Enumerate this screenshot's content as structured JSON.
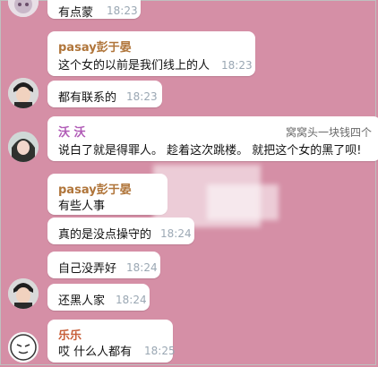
{
  "messages": [
    {
      "sender": "",
      "text": "有点蒙",
      "time": "18:23"
    },
    {
      "sender": "pasay彭于晏",
      "sender_color": "#b0753a",
      "text": "这个女的以前是我们线上的人",
      "time": "18:23"
    },
    {
      "sender": "",
      "text": "都有联系的",
      "time": "18:23"
    },
    {
      "sender": "沃 沃",
      "sender_color": "#b05ab6",
      "text": "说白了就是得罪人。 趁着这次跳楼。 就把这个女的黑了呗!",
      "right_text": "窝窝头一块钱四个",
      "time": ""
    },
    {
      "sender": "pasay彭于晏",
      "sender_color": "#b0753a",
      "text": "有些人事",
      "time": ""
    },
    {
      "sender": "",
      "text": "真的是没点操守的",
      "time": "18:24"
    },
    {
      "sender": "",
      "text": "自己没弄好",
      "time": "18:24"
    },
    {
      "sender": "",
      "text": "还黑人家",
      "time": "18:24"
    },
    {
      "sender": "乐乐",
      "sender_color": "#c8603a",
      "text": "哎  什么人都有",
      "time": "18:25"
    }
  ],
  "avatars": {
    "top": "anime-avatar",
    "man": "man-avatar",
    "woman": "person-avatar",
    "meme": "meme-avatar"
  }
}
